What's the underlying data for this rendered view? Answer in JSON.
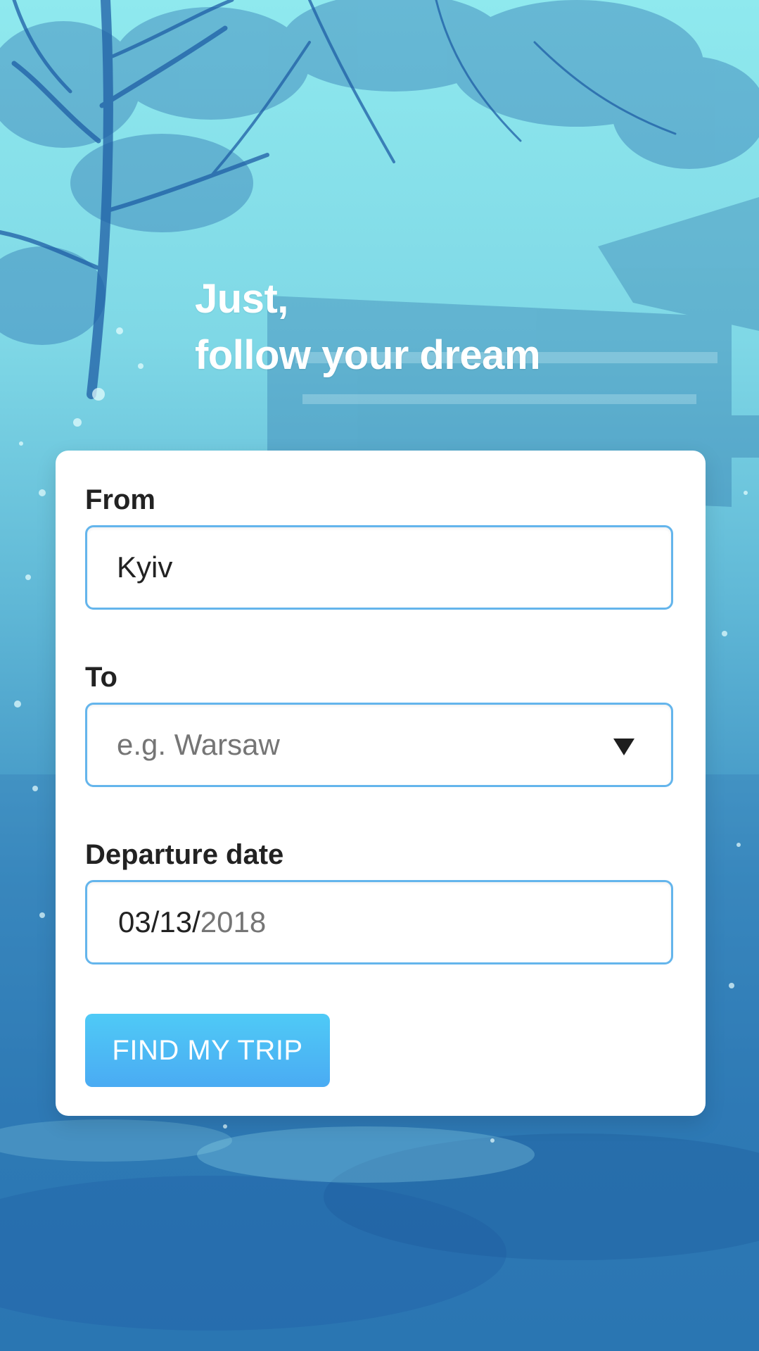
{
  "headline": {
    "line1": "Just,",
    "line2": "follow your dream"
  },
  "form": {
    "from": {
      "label": "From",
      "value": "Kyiv"
    },
    "to": {
      "label": "To",
      "placeholder": "e.g. Warsaw"
    },
    "departure": {
      "label": "Departure date",
      "date_month_day": "03/13/",
      "date_year": "2018"
    },
    "submit_label": "FIND MY TRIP"
  },
  "colors": {
    "field_border": "#64b5ec",
    "button": "#4aabf3",
    "background_top": "#8fe9ee",
    "background_bottom": "#2a78b3"
  }
}
